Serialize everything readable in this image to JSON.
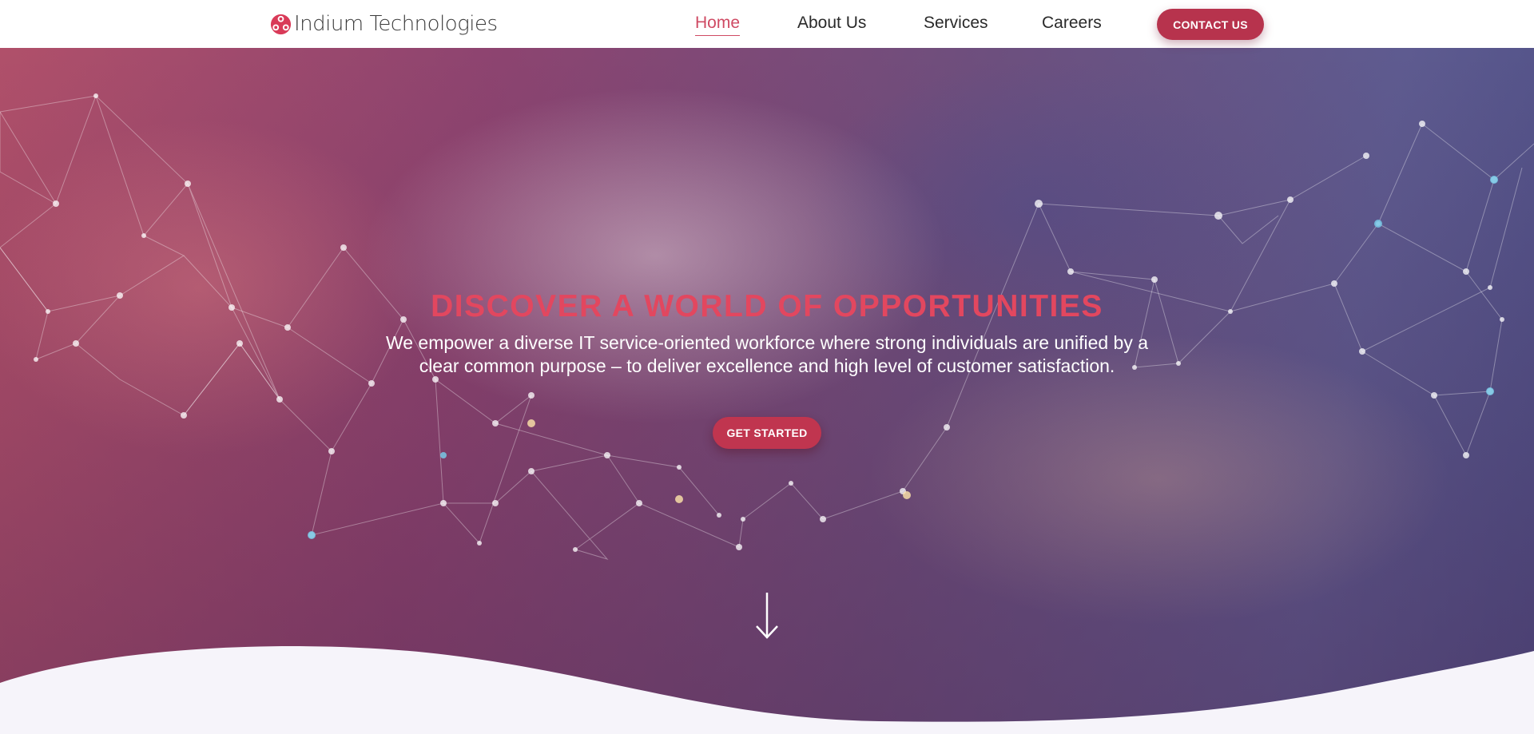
{
  "header": {
    "logo_text": "Indium Technologies",
    "nav": [
      {
        "label": "Home",
        "active": true
      },
      {
        "label": "About Us",
        "active": false
      },
      {
        "label": "Services",
        "active": false
      },
      {
        "label": "Careers",
        "active": false
      }
    ],
    "contact_label": "CONTACT US"
  },
  "hero": {
    "title": "DISCOVER A WORLD OF OPPORTUNITIES",
    "subtitle": "We empower a diverse IT service-oriented workforce where strong individuals are unified by a clear common purpose – to deliver excellence and high level of customer satisfaction.",
    "cta_label": "GET STARTED",
    "scroll_icon": "arrow-down-icon"
  },
  "colors": {
    "accent": "#cf4a63",
    "button": "#b7334d",
    "title": "#e2475f",
    "page_bg": "#f6f4fa"
  }
}
